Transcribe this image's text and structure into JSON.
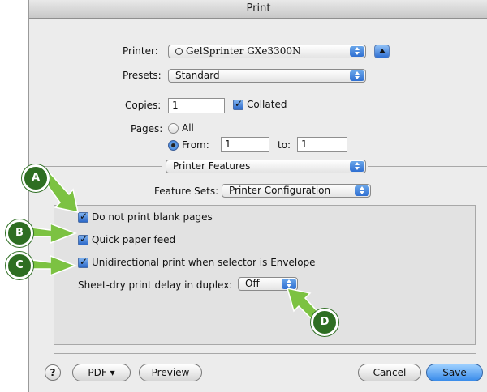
{
  "window": {
    "title": "Print"
  },
  "printer": {
    "label": "Printer:",
    "value": "GelSprinter GXe3300N",
    "status_icon": "printer-status-circle-icon",
    "expand_icon": "disclosure-up-icon"
  },
  "presets": {
    "label": "Presets:",
    "value": "Standard"
  },
  "copies": {
    "label": "Copies:",
    "value": "1",
    "collated_label": "Collated",
    "collated_checked": true
  },
  "pages": {
    "label": "Pages:",
    "all_label": "All",
    "from_label": "From:",
    "from_value": "1",
    "to_label": "to:",
    "to_value": "1",
    "selected": "From"
  },
  "section_popup": {
    "value": "Printer Features"
  },
  "feature_sets": {
    "label": "Feature Sets:",
    "value": "Printer Configuration"
  },
  "options": [
    {
      "label": "Do not print blank pages",
      "checked": true
    },
    {
      "label": "Quick paper feed",
      "checked": true
    },
    {
      "label": "Unidirectional print when selector is Envelope",
      "checked": true
    }
  ],
  "sheet_dry": {
    "label": "Sheet-dry print delay in duplex:",
    "value": "Off"
  },
  "footer": {
    "help": "?",
    "pdf": "PDF ▾",
    "preview": "Preview",
    "cancel": "Cancel",
    "save": "Save"
  },
  "callouts": [
    "A",
    "B",
    "C",
    "D"
  ],
  "colors": {
    "callout_green": "#2e6e22",
    "arrow_green": "#7cc242",
    "accent_blue": "#3a8cea"
  }
}
